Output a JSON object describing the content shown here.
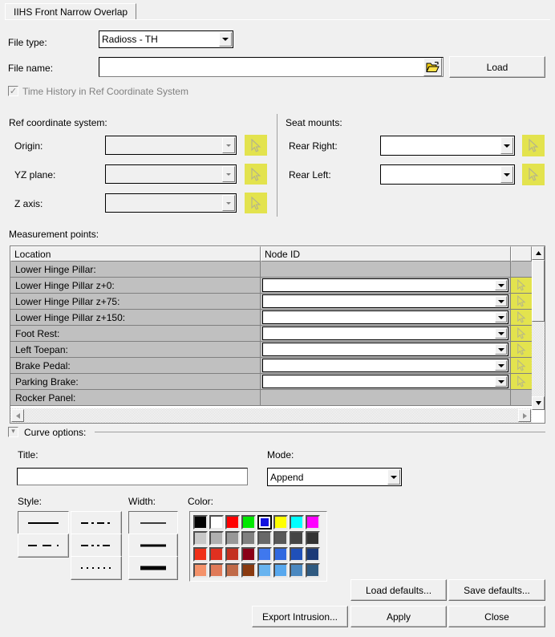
{
  "window": {
    "tab_label": "IIHS Front Narrow Overlap"
  },
  "file_section": {
    "file_type_label": "File type:",
    "file_type_value": "Radioss - TH",
    "file_name_label": "File name:",
    "file_name_value": "",
    "browse_icon": "open-folder-icon",
    "load_button": "Load",
    "time_history_checkbox_label": "Time History in Ref Coordinate System",
    "time_history_checked": true,
    "time_history_enabled": false
  },
  "ref_coordinate_system": {
    "group_label": "Ref coordinate system:",
    "rows": [
      {
        "label": "Origin:",
        "value": ""
      },
      {
        "label": "YZ plane:",
        "value": ""
      },
      {
        "label": "Z axis:",
        "value": ""
      }
    ],
    "pick_icon": "cursor-arrow-icon"
  },
  "seat_mounts": {
    "group_label": "Seat mounts:",
    "rows": [
      {
        "label": "Rear Right:",
        "value": ""
      },
      {
        "label": "Rear Left:",
        "value": ""
      }
    ],
    "pick_icon": "cursor-arrow-icon"
  },
  "measurement_points": {
    "group_label": "Measurement points:",
    "columns": [
      "Location",
      "Node ID"
    ],
    "rows": [
      {
        "location": "Lower Hinge Pillar:",
        "node_id": "",
        "has_input": false,
        "has_pick": false
      },
      {
        "location": "Lower Hinge Pillar z+0:",
        "node_id": "",
        "has_input": true,
        "has_pick": true
      },
      {
        "location": "Lower Hinge Pillar z+75:",
        "node_id": "",
        "has_input": true,
        "has_pick": true
      },
      {
        "location": "Lower Hinge Pillar z+150:",
        "node_id": "",
        "has_input": true,
        "has_pick": true
      },
      {
        "location": "Foot Rest:",
        "node_id": "",
        "has_input": true,
        "has_pick": true
      },
      {
        "location": "Left Toepan:",
        "node_id": "",
        "has_input": true,
        "has_pick": true
      },
      {
        "location": "Brake Pedal:",
        "node_id": "",
        "has_input": true,
        "has_pick": true
      },
      {
        "location": "Parking Brake:",
        "node_id": "",
        "has_input": true,
        "has_pick": true
      },
      {
        "location": "Rocker Panel:",
        "node_id": "",
        "has_input": false,
        "has_pick": false
      }
    ]
  },
  "curve_options": {
    "group_label": "Curve options:",
    "expanded": true,
    "title_label": "Title:",
    "title_value": "",
    "mode_label": "Mode:",
    "mode_value": "Append",
    "style_label": "Style:",
    "width_label": "Width:",
    "color_label": "Color:",
    "styles": [
      {
        "name": "solid",
        "dash": "",
        "selected": true
      },
      {
        "name": "dash-dot",
        "dash": "9,4,3,4",
        "selected": false
      },
      {
        "name": "dashed",
        "dash": "11,7",
        "selected": false
      },
      {
        "name": "dash-dot-dot",
        "dash": "9,4,3,4,3,4",
        "selected": false
      },
      {
        "name": "dotted",
        "dash": "2,5",
        "selected": false
      }
    ],
    "widths": [
      {
        "name": "thin",
        "px": 1.5,
        "selected": true
      },
      {
        "name": "medium",
        "px": 3,
        "selected": false
      },
      {
        "name": "thick",
        "px": 5,
        "selected": false
      }
    ],
    "palette": [
      [
        "#000000",
        "#ffffff",
        "#ff0000",
        "#00e800",
        "#1212e0",
        "#ffff00",
        "#00ffff",
        "#ff00ff"
      ],
      [
        "#c8c8c8",
        "#b0b0b0",
        "#989898",
        "#808080",
        "#686868",
        "#585858",
        "#454545",
        "#333333"
      ],
      [
        "#f03018",
        "#e03020",
        "#c43020",
        "#8a0018",
        "#3f78ee",
        "#2f68e0",
        "#2050b8",
        "#1c3a78"
      ],
      [
        "#f4926a",
        "#e07a58",
        "#c06a48",
        "#8a3a10",
        "#68b4f0",
        "#58a8ee",
        "#4a88c0",
        "#2f5a80"
      ]
    ],
    "selected_color": "#1212e0",
    "selected_color_row": 0,
    "selected_color_col": 4
  },
  "actions": {
    "load_defaults": "Load defaults...",
    "save_defaults": "Save defaults...",
    "export_intrusion": "Export Intrusion...",
    "apply": "Apply",
    "close": "Close"
  }
}
